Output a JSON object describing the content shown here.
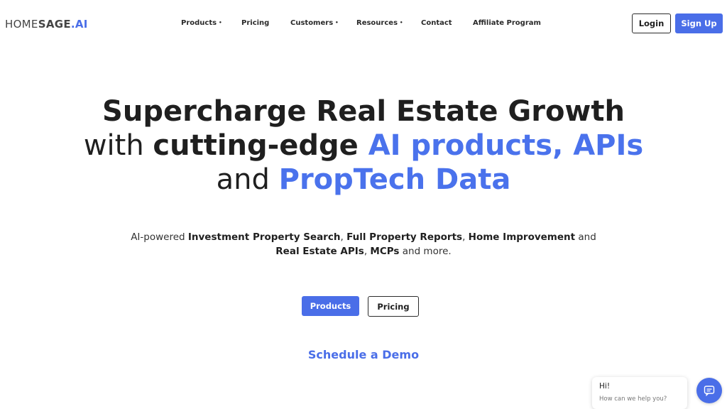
{
  "header": {
    "logo": {
      "part1": "HOME",
      "part2": "SAGE",
      "part3": ".AI"
    },
    "nav": [
      {
        "label": "Products",
        "caret": "•"
      },
      {
        "label": "Pricing"
      },
      {
        "label": "Customers",
        "caret": "•"
      },
      {
        "label": "Resources",
        "caret": "•"
      },
      {
        "label": "Contact"
      },
      {
        "label": "Affiliate Program"
      }
    ],
    "login_label": "Login",
    "signup_label": "Sign Up"
  },
  "hero": {
    "line1": "Supercharge Real Estate Growth",
    "line2_prefix": "with ",
    "line2_bold": "cutting-edge ",
    "line2_blue": "AI products, APIs",
    "line3_prefix": "and ",
    "line3_blue": "PropTech Data",
    "sub": {
      "t1": "AI-powered ",
      "b1": "Investment Property Search",
      "t2": ", ",
      "b2": "Full Property Reports",
      "t3": ", ",
      "b3": "Home Improvement",
      "t4": " and",
      "b4": "Real Estate APIs",
      "t5": ", ",
      "b5": "MCPs",
      "t6": " and more."
    },
    "products_button": "Products",
    "pricing_button": "Pricing",
    "demo_link": "Schedule a Demo"
  },
  "chat": {
    "greeting": "Hi!",
    "prompt": "How can we help you?",
    "icon": "chat-icon"
  },
  "colors": {
    "accent": "#4a6ee8",
    "text": "#1f1f1f"
  }
}
